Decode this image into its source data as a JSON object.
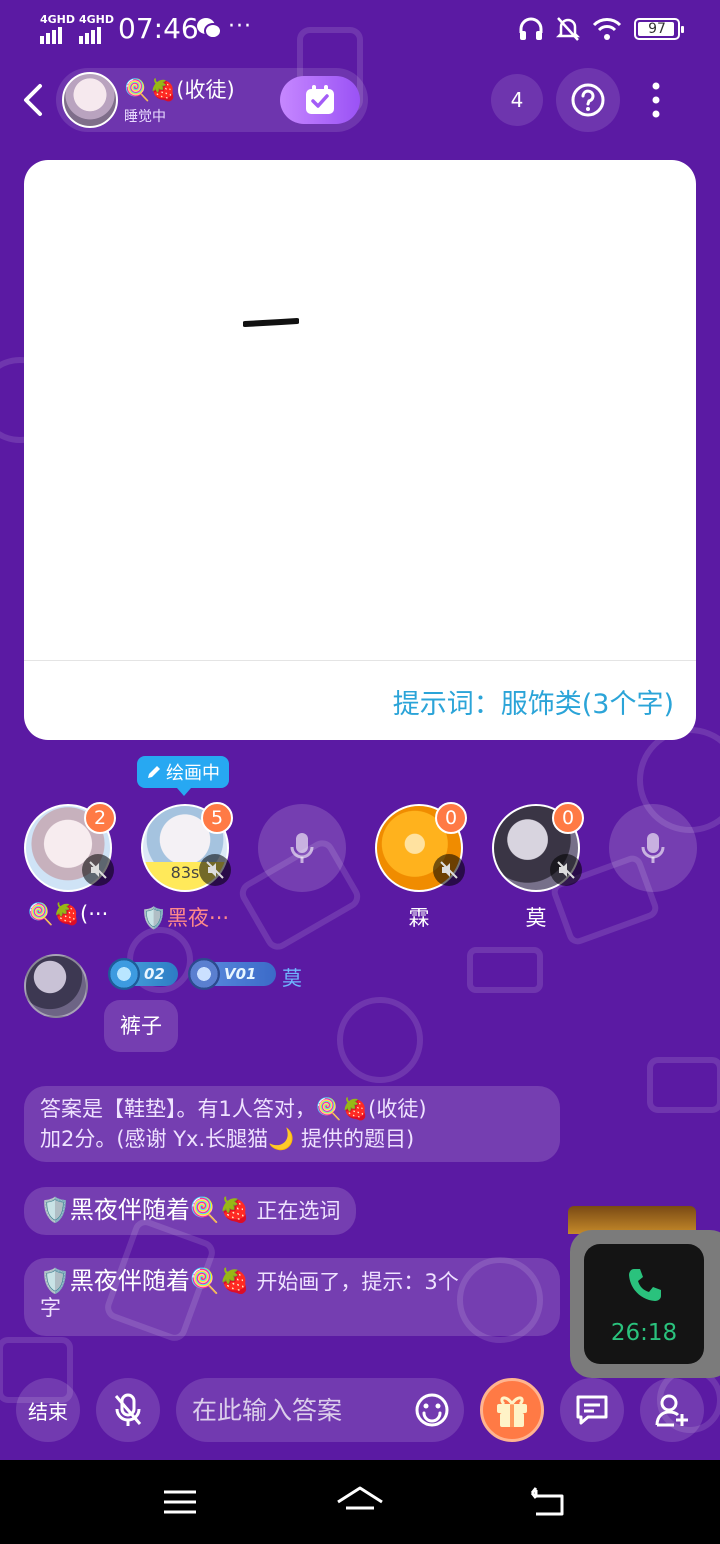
{
  "status_bar": {
    "network_1": "4GHD",
    "network_2": "4GHD",
    "time": "07:46",
    "more": "···",
    "battery": "97",
    "icons": [
      "wechat-icon",
      "headphones-icon",
      "mute-bell-icon",
      "wifi-icon",
      "battery-icon"
    ]
  },
  "header": {
    "room_name": "🍭🍓(收徒)",
    "room_status": "睡觉中",
    "online_count": "4",
    "icons": [
      "back-icon",
      "checkin-icon",
      "help-icon",
      "more-vertical-icon"
    ]
  },
  "canvas": {
    "hint": "提示词：服饰类(3个字)"
  },
  "drawing_tag": "绘画中",
  "players": [
    {
      "name": "🍭🍓(···",
      "score": "2",
      "muted": true
    },
    {
      "name": "🛡️黑夜···",
      "score": "5",
      "muted": true,
      "timer": "83s",
      "drawing": true
    },
    {
      "empty": true
    },
    {
      "name": "霖",
      "score": "0",
      "muted": true
    },
    {
      "name": "莫",
      "score": "0",
      "muted": true
    },
    {
      "empty": true
    }
  ],
  "chat": {
    "badge_1": "02",
    "badge_2": "V01",
    "name": "莫",
    "message": "裤子"
  },
  "system_messages": [
    {
      "line1": "答案是【鞋垫】。有1人答对，🍭🍓(收徒)",
      "line2": "加2分。(感谢 Yx.长腿猫🌙 提供的题目)"
    },
    {
      "name": "🛡️黑夜伴随着🍭🍓",
      "text": " 正在选词"
    },
    {
      "name": "🛡️黑夜伴随着🍭🍓",
      "text": " 开始画了，提示：3个",
      "text2": "字"
    }
  ],
  "call": {
    "duration": "26:18"
  },
  "bottom_bar": {
    "end_label": "结束",
    "answer_placeholder": "在此输入答案"
  },
  "colors": {
    "background": "#5b1aa3",
    "hint": "#2ba4d8",
    "score_badge": "#ff7a45",
    "drawing_tag": "#27a8f2",
    "call_time": "#2ac27d"
  }
}
